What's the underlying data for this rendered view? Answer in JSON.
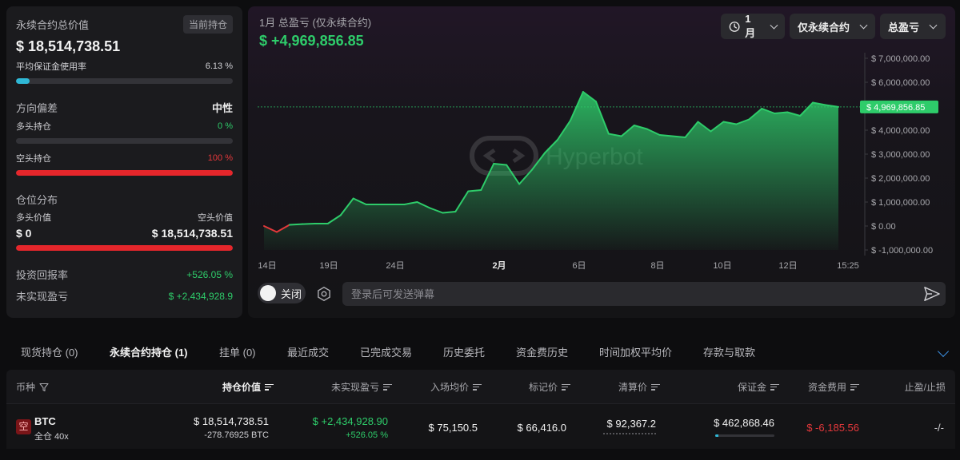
{
  "summary": {
    "title": "永续合约总价值",
    "badge": "当前持仓",
    "total_value": "$ 18,514,738.51",
    "margin_usage_label": "平均保证金使用率",
    "margin_usage_pct": "6.13 %",
    "margin_usage_fraction": 0.0613,
    "direction_label": "方向偏差",
    "direction_value": "中性",
    "long_label": "多头持仓",
    "long_pct": "0 %",
    "long_fraction": 0,
    "short_label": "空头持仓",
    "short_pct": "100 %",
    "short_fraction": 1,
    "distribution_label": "仓位分布",
    "long_value_label": "多头价值",
    "short_value_label": "空头价值",
    "long_value": "$ 0",
    "short_value": "$ 18,514,738.51",
    "roi_label": "投资回报率",
    "roi_value": "+526.05 %",
    "upnl_label": "未实现盈亏",
    "upnl_value": "$ +2,434,928.9"
  },
  "chart_panel": {
    "title": "1月 总盈亏 (仅永续合约)",
    "total": "$ +4,969,856.85",
    "dropdowns": [
      "1月",
      "仅永续合约",
      "总盈亏"
    ],
    "watermark": "Hyperbot",
    "toggle_label": "关闭",
    "danmaku_placeholder": "登录后可发送弹幕"
  },
  "chart_data": {
    "type": "area",
    "title": "1月 总盈亏 (仅永续合约)",
    "x_ticks": [
      "14日",
      "19日",
      "24日",
      "2月",
      "6日",
      "8日",
      "10日",
      "12日",
      "15:25"
    ],
    "y_ticks": [
      "$ 7,000,000.00",
      "$ 6,000,000.00",
      "$ 5,000,000.00",
      "$ 4,000,000.00",
      "$ 3,000,000.00",
      "$ 2,000,000.00",
      "$ 1,000,000.00",
      "$ 0.00",
      "$ -1,000,000.00"
    ],
    "ylim": [
      -1000000,
      7000000
    ],
    "y_tick_values": [
      7000000,
      6000000,
      5000000,
      4000000,
      3000000,
      2000000,
      1000000,
      0,
      -1000000
    ],
    "current_value_label": "$ 4,969,856.85",
    "current_value": 4969856.85,
    "colors": {
      "positive": "#2ecc6a",
      "negative": "#e5383b"
    },
    "values": [
      0,
      -250000,
      50000,
      80000,
      100000,
      100000,
      450000,
      1150000,
      900000,
      900000,
      900000,
      900000,
      1000000,
      750000,
      550000,
      600000,
      1450000,
      1500000,
      2600000,
      2550000,
      1750000,
      2350000,
      3050000,
      3600000,
      4400000,
      5600000,
      5200000,
      3850000,
      3750000,
      4200000,
      4050000,
      3800000,
      3750000,
      3700000,
      4350000,
      3950000,
      4350000,
      4250000,
      4450000,
      4900000,
      4700000,
      4750000,
      4600000,
      5150000,
      5050000,
      4969856.85
    ]
  },
  "tabs": [
    {
      "label": "现货持仓 (0)",
      "active": false
    },
    {
      "label": "永续合约持仓 (1)",
      "active": true
    },
    {
      "label": "挂单 (0)",
      "active": false
    },
    {
      "label": "最近成交",
      "active": false
    },
    {
      "label": "已完成交易",
      "active": false
    },
    {
      "label": "历史委托",
      "active": false
    },
    {
      "label": "资金费历史",
      "active": false
    },
    {
      "label": "时间加权平均价",
      "active": false
    },
    {
      "label": "存款与取款",
      "active": false
    }
  ],
  "table": {
    "headers": [
      "币种",
      "持仓价值",
      "未实现盈亏",
      "入场均价",
      "标记价",
      "清算价",
      "保证金",
      "资金费用",
      "止盈/止损"
    ],
    "row": {
      "side_badge": "空",
      "coin": "BTC",
      "mode": "全仓 40x",
      "position_value": "$ 18,514,738.51",
      "position_size": "-278.76925 BTC",
      "upnl": "$ +2,434,928.90",
      "upnl_pct": "+526.05 %",
      "entry_price": "$ 75,150.5",
      "mark_price": "$ 66,416.0",
      "liq_price": "$ 92,367.2",
      "margin": "$ 462,868.46",
      "margin_fraction": 0.06,
      "funding": "$ -6,185.56",
      "tpsl": "-/-"
    }
  }
}
